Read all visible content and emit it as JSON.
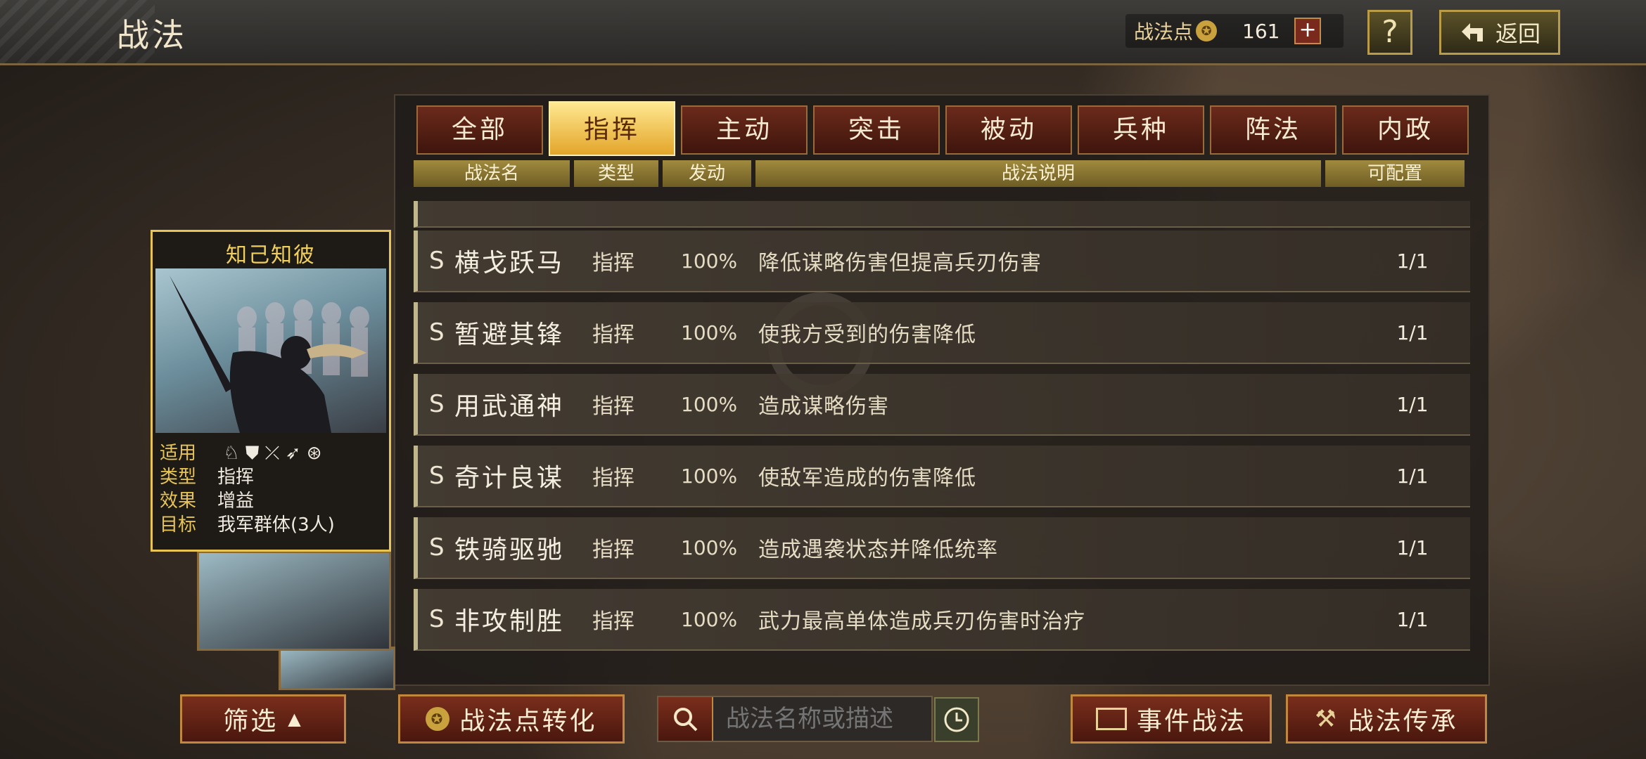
{
  "header": {
    "title": "战法",
    "points_label": "战法点",
    "points_value": "161",
    "plus_symbol": "+",
    "help_symbol": "?",
    "back_label": "返回"
  },
  "tabs": [
    "全部",
    "指挥",
    "主动",
    "突击",
    "被动",
    "兵种",
    "阵法",
    "内政"
  ],
  "active_tab": 1,
  "columns": [
    "战法名",
    "类型",
    "发动",
    "战法说明",
    "可配置"
  ],
  "rows": [
    {
      "grade": "S",
      "name": "横戈跃马",
      "type": "指挥",
      "rate": "100%",
      "desc": "降低谋略伤害但提高兵刃伤害",
      "cfg": "1/1"
    },
    {
      "grade": "S",
      "name": "暂避其锋",
      "type": "指挥",
      "rate": "100%",
      "desc": "使我方受到的伤害降低",
      "cfg": "1/1"
    },
    {
      "grade": "S",
      "name": "用武通神",
      "type": "指挥",
      "rate": "100%",
      "desc": "造成谋略伤害",
      "cfg": "1/1"
    },
    {
      "grade": "S",
      "name": "奇计良谋",
      "type": "指挥",
      "rate": "100%",
      "desc": "使敌军造成的伤害降低",
      "cfg": "1/1"
    },
    {
      "grade": "S",
      "name": "铁骑驱驰",
      "type": "指挥",
      "rate": "100%",
      "desc": "造成遇袭状态并降低统率",
      "cfg": "1/1"
    },
    {
      "grade": "S",
      "name": "非攻制胜",
      "type": "指挥",
      "rate": "100%",
      "desc": "武力最高单体造成兵刃伤害时治疗",
      "cfg": "1/1"
    }
  ],
  "card": {
    "name": "知己知彼",
    "labels": {
      "apply": "适用",
      "type": "类型",
      "effect": "效果",
      "target": "目标"
    },
    "type": "指挥",
    "effect": "增益",
    "target": "我军群体(3人)"
  },
  "bottom": {
    "filter_label": "筛选",
    "convert_label": "战法点转化",
    "search_placeholder": "战法名称或描述",
    "event_label": "事件战法",
    "inherit_label": "战法传承"
  },
  "colors": {
    "accent_gold": "#e8c454",
    "tab_active": "#f0c24a",
    "button_red": "#6b2a1a"
  }
}
